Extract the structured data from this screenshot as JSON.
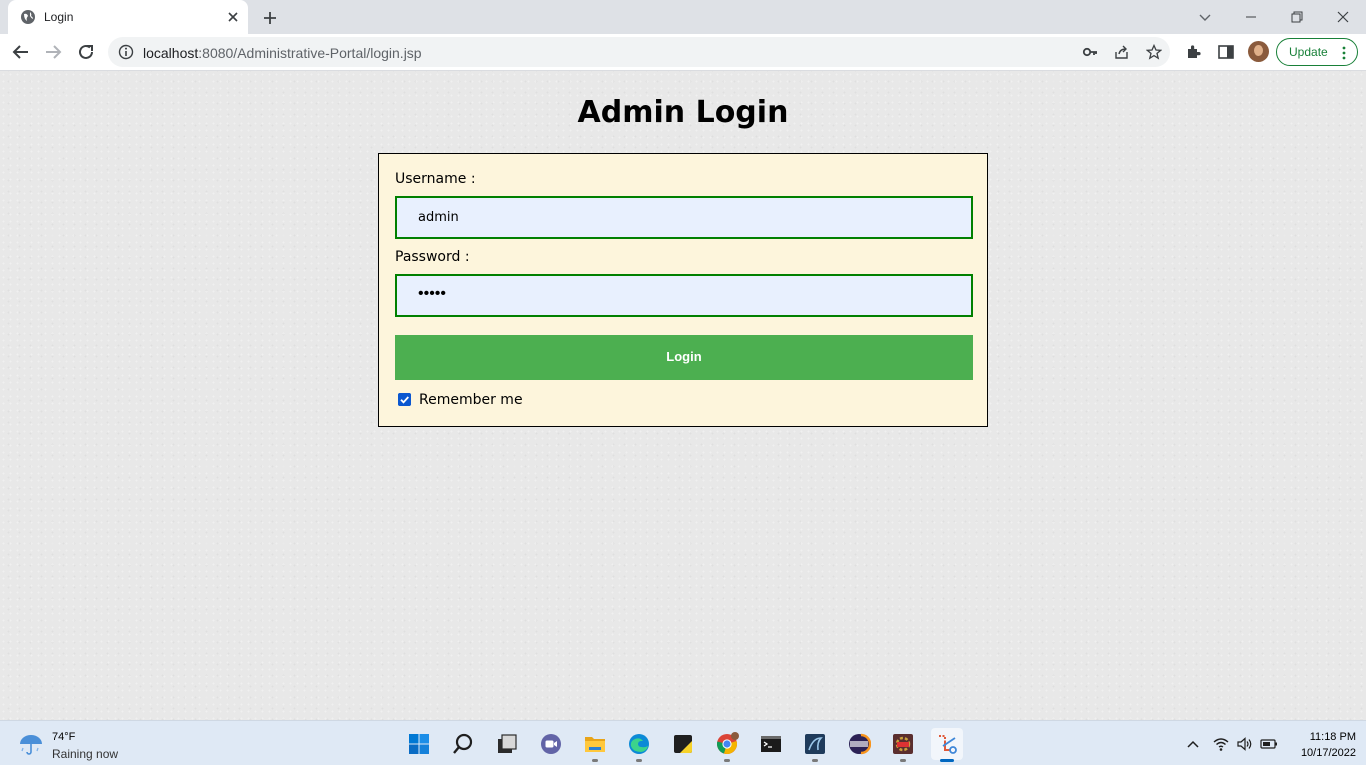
{
  "browser": {
    "tab_title": "Login",
    "url_host": "localhost",
    "url_rest": ":8080/Administrative-Portal/login.jsp",
    "update_label": "Update"
  },
  "page": {
    "title": "Admin Login",
    "username_label": "Username :",
    "username_value": "admin",
    "password_label": "Password :",
    "password_masked": "•••••",
    "login_label": "Login",
    "remember_label": "Remember me",
    "remember_checked": true
  },
  "taskbar": {
    "weather_temp": "74°F",
    "weather_condition": "Raining now",
    "time": "11:18 PM",
    "date": "10/17/2022",
    "apps": [
      "start-icon",
      "search-icon",
      "task-view-icon",
      "teams-chat-icon",
      "file-explorer-icon",
      "edge-icon",
      "sticky-notes-icon",
      "chrome-icon",
      "terminal-icon",
      "mysql-workbench-icon",
      "eclipse-icon",
      "devcpp-icon",
      "snipping-tool-icon"
    ]
  },
  "colors": {
    "accent_green": "#4caf50",
    "field_border": "#008000",
    "box_background": "#fdf5dc",
    "update_green": "#188038"
  }
}
